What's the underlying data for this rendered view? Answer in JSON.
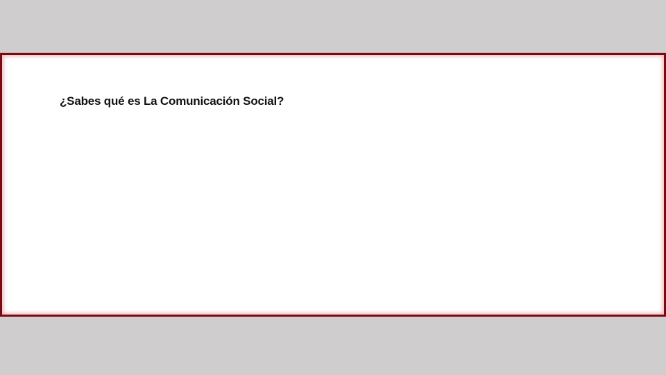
{
  "slide": {
    "question": "¿Sabes qué es La Comunicación Social?"
  },
  "colors": {
    "background": "#d0cdce",
    "panel": "#ffffff",
    "border": "#7a0a10",
    "text": "#111111"
  }
}
